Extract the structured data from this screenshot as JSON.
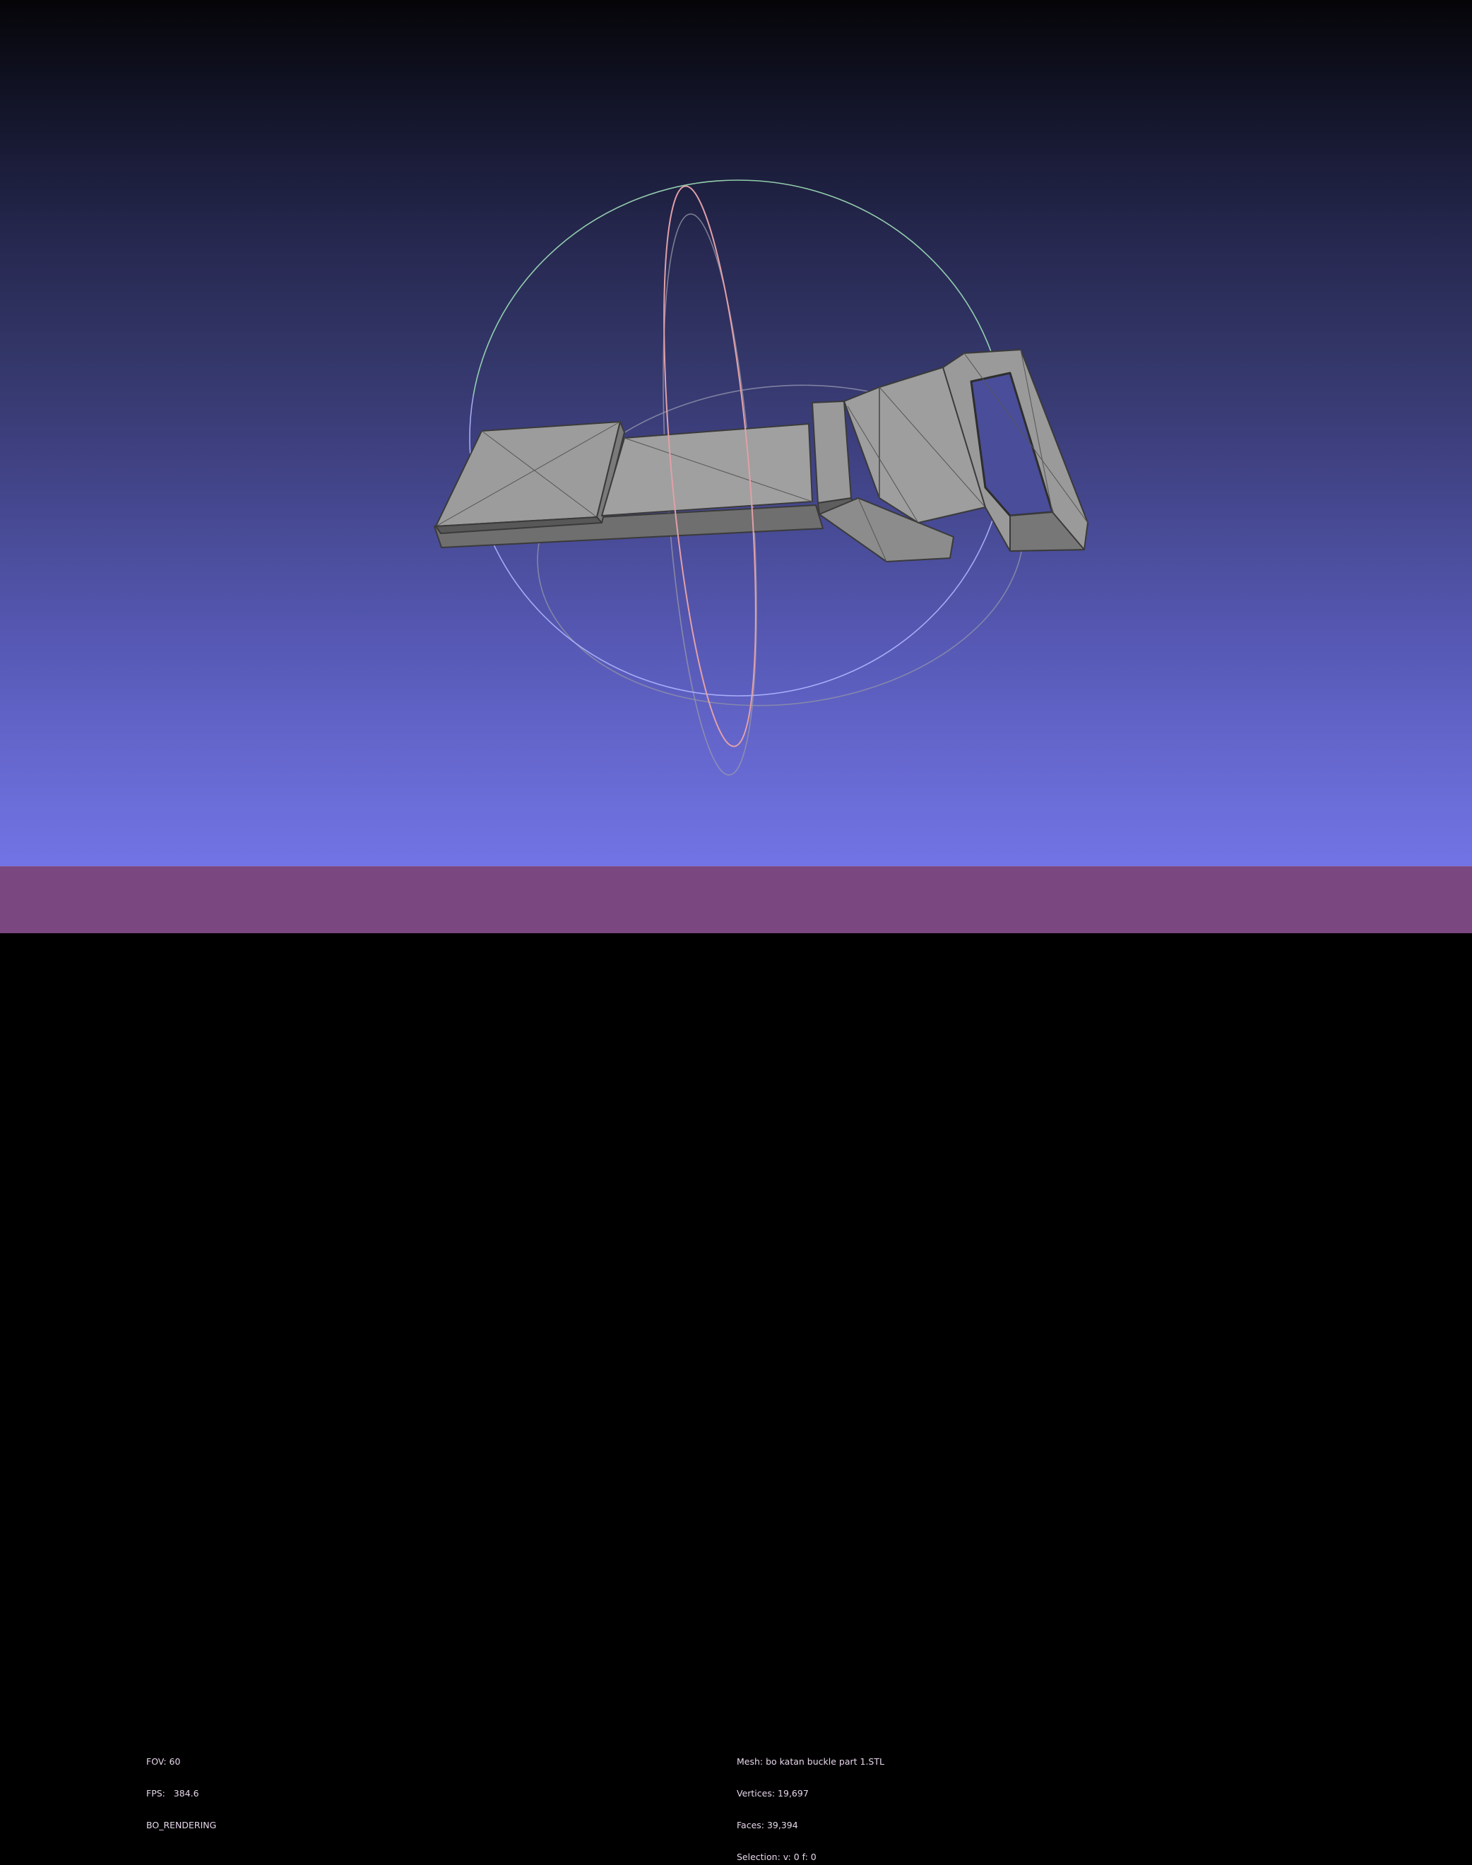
{
  "viewer": {
    "background_top": "#050508",
    "background_bottom": "#7274e6",
    "statusbar_color": "#7b4780",
    "gizmo": {
      "x_ring_color": "#e2a0a8",
      "y_ring_color": "#9fe0b8",
      "z_ring_color": "#b0b6ff",
      "guide_ring_color": "#8a8aa0"
    },
    "model_color": "#9b9b9b",
    "wire_color": "#3a3a3a"
  },
  "status_left": {
    "fov": "FOV: 60",
    "fps": "FPS:   384.6",
    "mode": "BO_RENDERING"
  },
  "status_right": {
    "mesh": "Mesh: bo katan buckle part 1.STL",
    "vertices": "Vertices: 19,697",
    "faces": "Faces: 39,394",
    "selection": "Selection: v: 0 f: 0"
  }
}
